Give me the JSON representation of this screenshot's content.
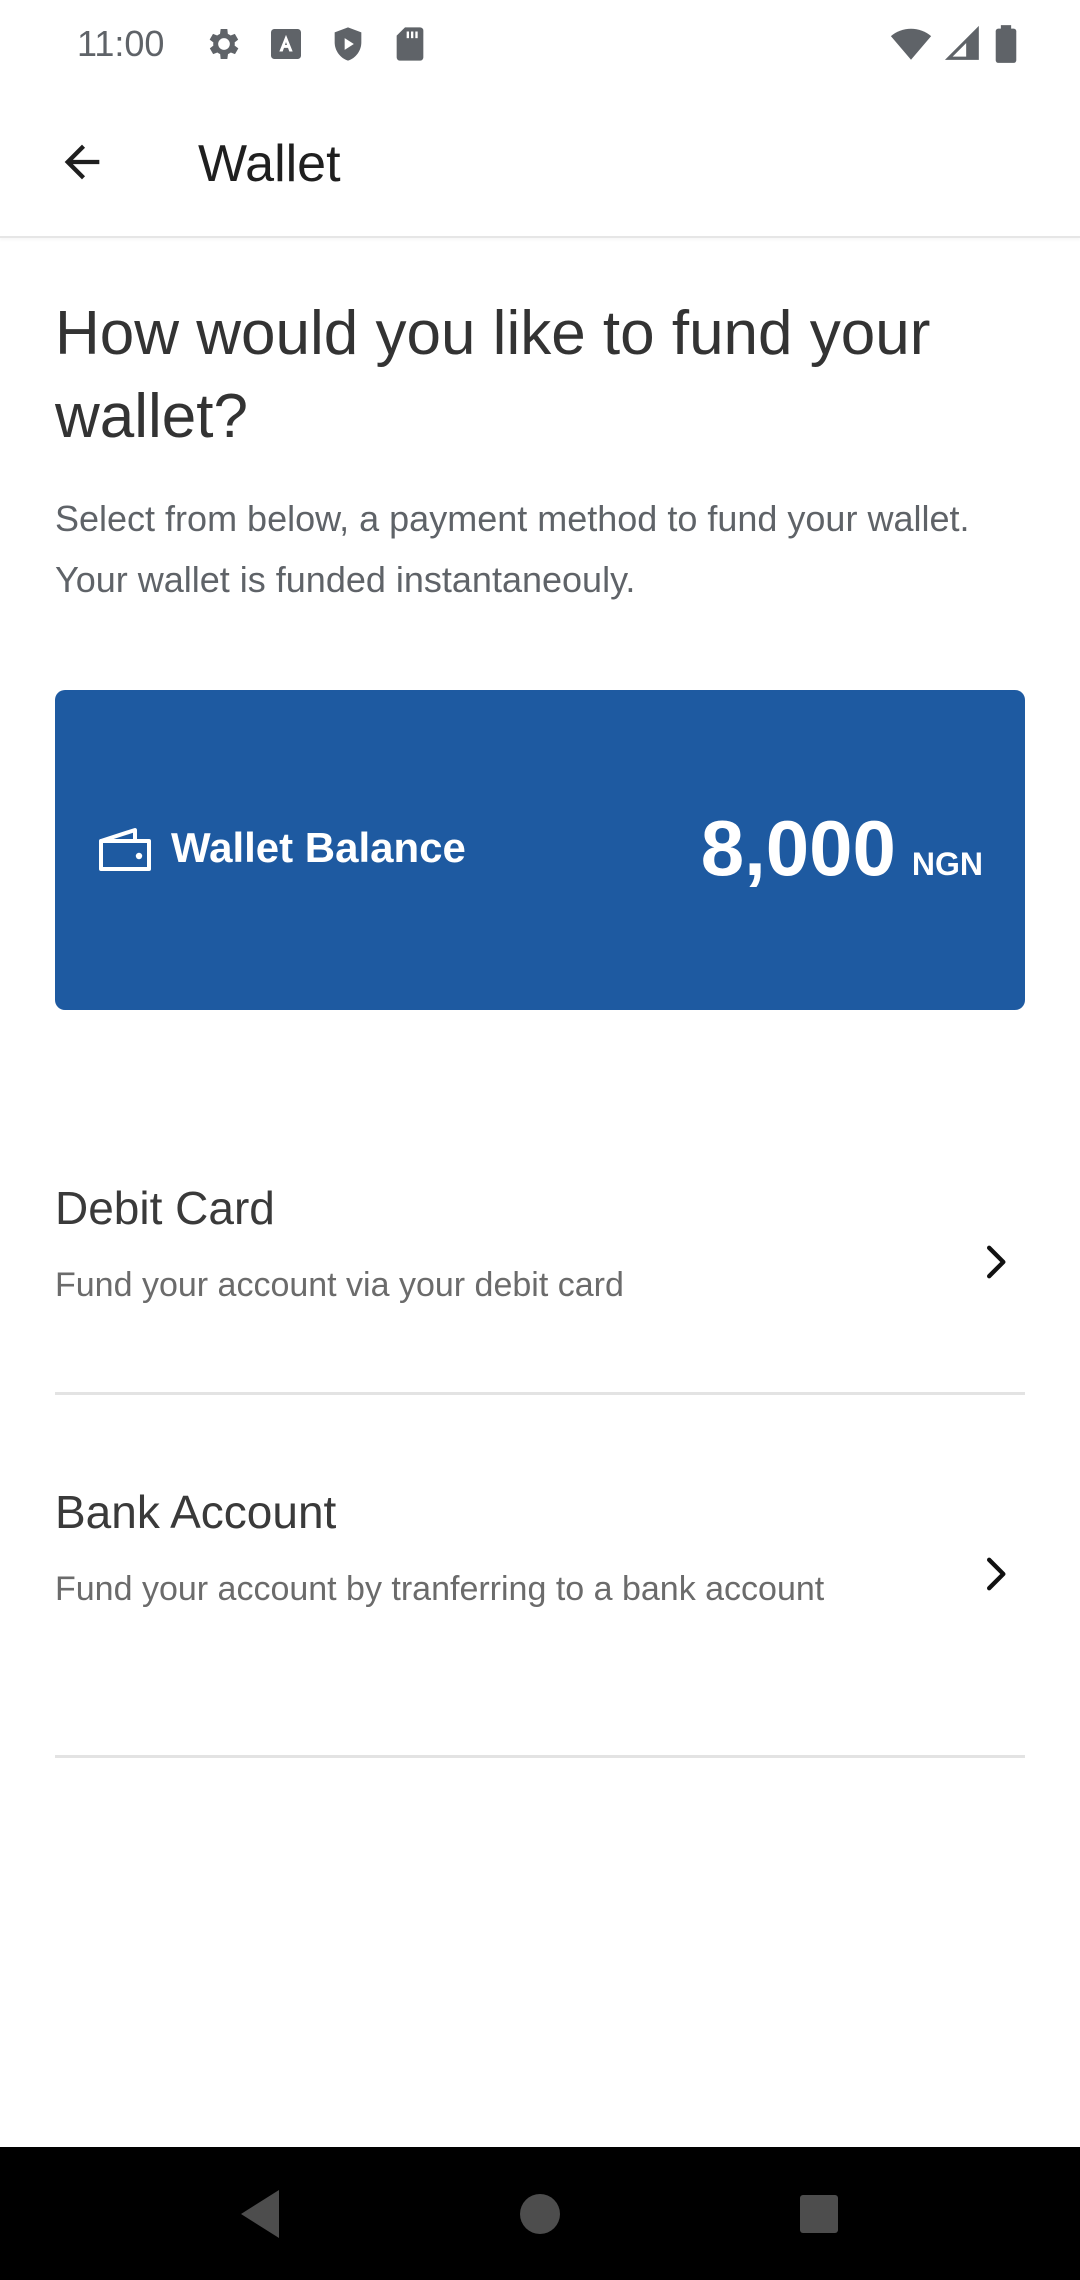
{
  "status_bar": {
    "time": "11:00",
    "left_icons": [
      "settings-icon",
      "font-icon",
      "shield-icon",
      "sd-card-icon"
    ],
    "right_icons": [
      "wifi-icon",
      "signal-icon",
      "battery-icon"
    ]
  },
  "app_bar": {
    "back_icon": "arrow-left-icon",
    "title": "Wallet"
  },
  "main": {
    "heading": "How would you like to fund your wallet?",
    "subheading": "Select from below, a payment method to fund your wallet. Your wallet is funded instantaneouly."
  },
  "balance_card": {
    "icon": "wallet-icon",
    "label": "Wallet Balance",
    "amount": "8,000",
    "currency": "NGN",
    "background_color": "#1e5aa1"
  },
  "options": [
    {
      "title": "Debit Card",
      "description": "Fund your account via your debit card",
      "icon": "chevron-right-icon"
    },
    {
      "title": "Bank Account",
      "description": "Fund your account by tranferring to a bank account",
      "icon": "chevron-right-icon"
    }
  ],
  "nav_bar": {
    "buttons": [
      "nav-back-icon",
      "nav-home-icon",
      "nav-recents-icon"
    ]
  }
}
